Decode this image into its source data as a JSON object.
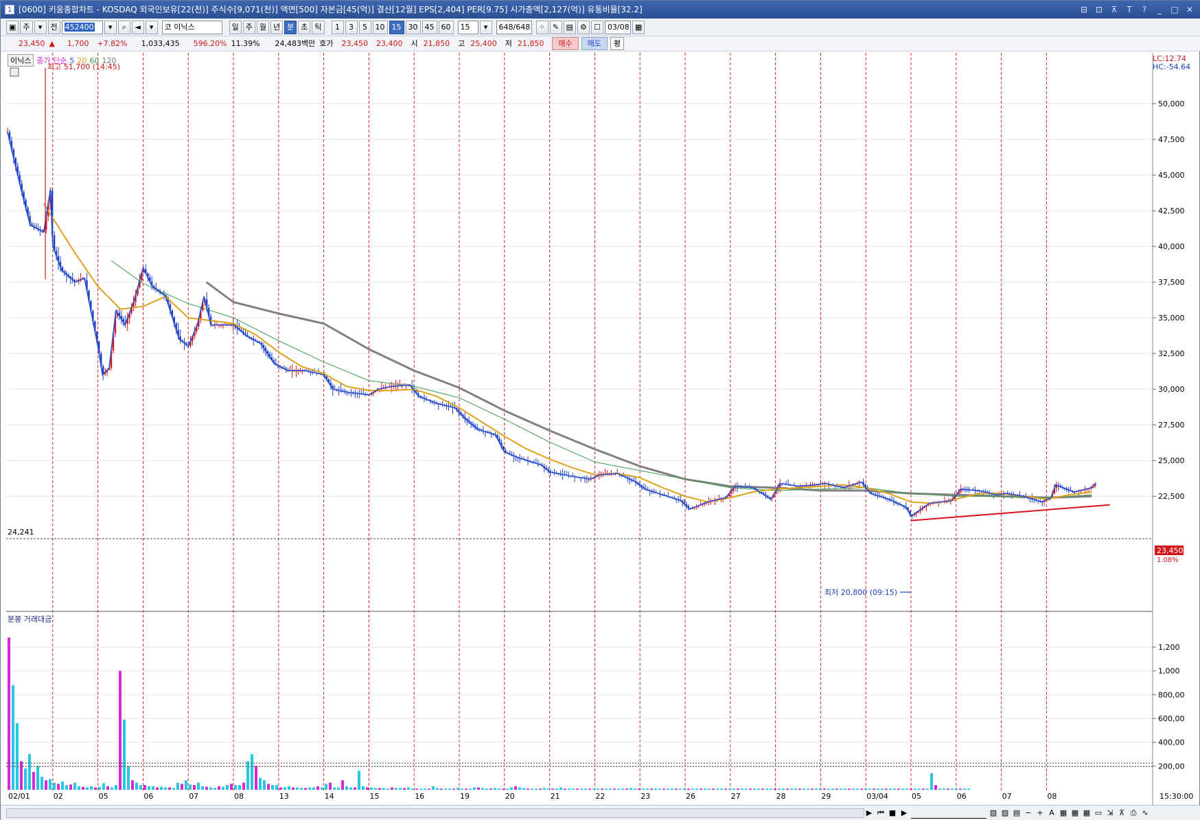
{
  "window": {
    "number": "1",
    "title": "[0600] 키움종합차트 - KOSDAQ 외국인보유[22(천)] 주식수[9,071(천)] 액면[500] 자본금[45(억)] 결산[12월] EPS[2,404] PER[9.75] 시가총액[2,127(억)] 유통비율[32.2]",
    "controls": [
      "⊟",
      "⊡",
      "⊼",
      "T",
      "?",
      "_",
      "□",
      "✕"
    ]
  },
  "toolbar": {
    "market_type": "주",
    "all_label": "전",
    "stock_code": "452400",
    "stock_market": "코",
    "stock_name": "이닉스",
    "periods": [
      "일",
      "주",
      "월",
      "년",
      "분",
      "초",
      "틱"
    ],
    "active_period": "분",
    "intervals": [
      "1",
      "3",
      "5",
      "10",
      "15",
      "30",
      "45",
      "60"
    ],
    "active_interval": "15",
    "interval_select": "15",
    "count": "648",
    "count_total": "/648",
    "date": "03/08"
  },
  "quote": {
    "price": "23,450",
    "change_arrow": "▲",
    "change": "1,700",
    "change_rate": "+7.82%",
    "volume": "1,033,435",
    "volume_rate": "596.20%",
    "turnover": "11.39%",
    "amount": "24,483백만",
    "bid_label": "호가",
    "ask_price": "23,450",
    "bid_price": "23,400",
    "open_label": "시",
    "open": "21,850",
    "high_label": "고",
    "high": "25,400",
    "low_label": "저",
    "low": "21,850",
    "buy_label": "매수",
    "sell_label": "매도",
    "flat_label": "평"
  },
  "legend": {
    "stock": "이닉스",
    "ma_label": "종가 단순",
    "ma": [
      {
        "period": "5",
        "color": "#2b4ecf"
      },
      {
        "period": "20",
        "color": "#e0a11a"
      },
      {
        "period": "60",
        "color": "#3a9b4a"
      },
      {
        "period": "120",
        "color": "#777777"
      }
    ],
    "lc": "LC:12.74",
    "hc": "HC:-54.64",
    "volume_title": "분봉 거래대금"
  },
  "annotations": {
    "high": "최고 51,700 (14:45)",
    "low": "최저 20,800 (09:15)",
    "ref_value": "24,241",
    "last_price": "23,450",
    "last_rate": "1.08%",
    "time_label": "15:30:00"
  },
  "chart_data": [
    {
      "type": "candlestick",
      "title": "",
      "ylim": [
        20000,
        52500
      ],
      "y_ticks": [
        "50,000",
        "47,500",
        "45,000",
        "42,500",
        "40,000",
        "37,500",
        "35,000",
        "32,500",
        "30,000",
        "27,500",
        "25,000",
        "22,500"
      ],
      "x_ticks": [
        "02/01",
        "02",
        "05",
        "06",
        "07",
        "08",
        "13",
        "14",
        "15",
        "16",
        "19",
        "20",
        "21",
        "22",
        "23",
        "26",
        "27",
        "28",
        "29",
        "03/04",
        "05",
        "06",
        "07",
        "08"
      ],
      "close_path": [
        [
          0,
          48000
        ],
        [
          0.3,
          44000
        ],
        [
          0.5,
          41500
        ],
        [
          0.8,
          41000
        ],
        [
          0.95,
          44000
        ],
        [
          1,
          40000
        ],
        [
          1.2,
          38300
        ],
        [
          1.5,
          37500
        ],
        [
          1.7,
          37800
        ],
        [
          2,
          33000
        ],
        [
          2.1,
          31000
        ],
        [
          2.25,
          31500
        ],
        [
          2.4,
          35500
        ],
        [
          2.6,
          34500
        ],
        [
          2.8,
          36200
        ],
        [
          3,
          38500
        ],
        [
          3.2,
          37200
        ],
        [
          3.5,
          36500
        ],
        [
          3.8,
          33500
        ],
        [
          4,
          33000
        ],
        [
          4.2,
          34500
        ],
        [
          4.35,
          36500
        ],
        [
          4.5,
          34500
        ],
        [
          4.8,
          34500
        ],
        [
          5,
          34500
        ],
        [
          5.3,
          33700
        ],
        [
          5.6,
          33200
        ],
        [
          5.9,
          31800
        ],
        [
          6.2,
          31300
        ],
        [
          6.6,
          31300
        ],
        [
          7,
          31000
        ],
        [
          7.2,
          30000
        ],
        [
          7.5,
          29800
        ],
        [
          8,
          29600
        ],
        [
          8.2,
          30000
        ],
        [
          8.5,
          30200
        ],
        [
          8.9,
          30300
        ],
        [
          9.1,
          29500
        ],
        [
          9.5,
          29000
        ],
        [
          9.9,
          28700
        ],
        [
          10.1,
          28000
        ],
        [
          10.4,
          27200
        ],
        [
          10.8,
          26800
        ],
        [
          11,
          25600
        ],
        [
          11.3,
          25200
        ],
        [
          11.8,
          24700
        ],
        [
          12,
          24200
        ],
        [
          12.5,
          23900
        ],
        [
          12.9,
          23700
        ],
        [
          13.1,
          24000
        ],
        [
          13.5,
          24100
        ],
        [
          13.9,
          23500
        ],
        [
          14.1,
          23000
        ],
        [
          14.5,
          22600
        ],
        [
          14.9,
          22200
        ],
        [
          15.1,
          21600
        ],
        [
          15.5,
          22100
        ],
        [
          15.9,
          22400
        ],
        [
          16.1,
          23200
        ],
        [
          16.5,
          23100
        ],
        [
          16.9,
          22300
        ],
        [
          17.1,
          23400
        ],
        [
          17.5,
          23200
        ],
        [
          17.9,
          23300
        ],
        [
          18.1,
          23400
        ],
        [
          18.5,
          23100
        ],
        [
          18.9,
          23500
        ],
        [
          19.1,
          22700
        ],
        [
          19.5,
          22300
        ],
        [
          19.9,
          21700
        ],
        [
          20,
          21100
        ],
        [
          20.4,
          22000
        ],
        [
          20.9,
          22200
        ],
        [
          21.1,
          23000
        ],
        [
          21.5,
          22900
        ],
        [
          21.9,
          22600
        ],
        [
          22.1,
          22700
        ],
        [
          22.5,
          22500
        ],
        [
          22.9,
          22100
        ],
        [
          23.1,
          22400
        ],
        [
          23.2,
          23300
        ],
        [
          23.6,
          22800
        ],
        [
          24,
          23100
        ],
        [
          24.1,
          23450
        ]
      ],
      "ma20_path": [
        [
          0.8,
          43000
        ],
        [
          1.5,
          39500
        ],
        [
          2,
          37200
        ],
        [
          2.5,
          35600
        ],
        [
          3,
          35800
        ],
        [
          3.5,
          36500
        ],
        [
          4,
          35000
        ],
        [
          4.5,
          34800
        ],
        [
          5,
          34600
        ],
        [
          5.5,
          33800
        ],
        [
          6,
          32600
        ],
        [
          6.5,
          31600
        ],
        [
          7,
          31100
        ],
        [
          7.5,
          30200
        ],
        [
          8,
          29900
        ],
        [
          8.5,
          29900
        ],
        [
          9,
          30000
        ],
        [
          9.5,
          29500
        ],
        [
          10,
          28700
        ],
        [
          10.5,
          27700
        ],
        [
          11,
          26700
        ],
        [
          11.5,
          25800
        ],
        [
          12,
          25100
        ],
        [
          12.5,
          24500
        ],
        [
          13,
          24000
        ],
        [
          13.5,
          24100
        ],
        [
          14,
          23800
        ],
        [
          14.5,
          23100
        ],
        [
          15,
          22500
        ],
        [
          15.5,
          22100
        ],
        [
          16,
          22400
        ],
        [
          16.5,
          22800
        ],
        [
          17,
          23000
        ],
        [
          17.5,
          23100
        ],
        [
          18,
          23200
        ],
        [
          18.5,
          23300
        ],
        [
          19,
          23100
        ],
        [
          19.5,
          22700
        ],
        [
          20,
          22100
        ],
        [
          20.5,
          22000
        ],
        [
          21,
          22300
        ],
        [
          21.5,
          22700
        ],
        [
          22,
          22700
        ],
        [
          22.5,
          22500
        ],
        [
          23,
          22300
        ],
        [
          23.5,
          22600
        ],
        [
          24,
          22800
        ]
      ],
      "ma60_path": [
        [
          2.3,
          39000
        ],
        [
          3,
          37400
        ],
        [
          4,
          36000
        ],
        [
          5,
          35000
        ],
        [
          6,
          33400
        ],
        [
          7,
          31900
        ],
        [
          8,
          30600
        ],
        [
          9,
          30200
        ],
        [
          10,
          29400
        ],
        [
          11,
          27900
        ],
        [
          12,
          26300
        ],
        [
          13,
          24900
        ],
        [
          14,
          24300
        ],
        [
          15,
          23700
        ],
        [
          16,
          23100
        ],
        [
          17,
          22900
        ],
        [
          18,
          23000
        ],
        [
          19,
          23100
        ],
        [
          20,
          22700
        ],
        [
          21,
          22500
        ],
        [
          22,
          22500
        ],
        [
          23,
          22400
        ],
        [
          24,
          22600
        ]
      ],
      "ma120_path": [
        [
          4.4,
          37500
        ],
        [
          5,
          36100
        ],
        [
          6,
          35300
        ],
        [
          7,
          34600
        ],
        [
          8,
          32800
        ],
        [
          9,
          31300
        ],
        [
          10,
          30100
        ],
        [
          11,
          28500
        ],
        [
          12,
          27100
        ],
        [
          13,
          25800
        ],
        [
          14,
          24600
        ],
        [
          15,
          23700
        ],
        [
          16,
          23200
        ],
        [
          17,
          23100
        ],
        [
          18,
          22900
        ],
        [
          19,
          22900
        ],
        [
          20,
          22700
        ],
        [
          21,
          22600
        ],
        [
          22,
          22500
        ],
        [
          23,
          22400
        ],
        [
          24,
          22500
        ]
      ],
      "trendline": [
        [
          20,
          20800
        ],
        [
          24.4,
          21900
        ]
      ]
    },
    {
      "type": "bar",
      "title": "분봉 거래대금",
      "ylim": [
        0,
        1350
      ],
      "y_ticks": [
        "1,200",
        "1,000",
        "800,00",
        "600,00",
        "400,00",
        "200,00"
      ],
      "values": [
        1280,
        880,
        560,
        240,
        180,
        300,
        150,
        200,
        110,
        80,
        90,
        60,
        50,
        70,
        40,
        45,
        60,
        30,
        25,
        20,
        30,
        20,
        25,
        55,
        30,
        20,
        40,
        1000,
        590,
        200,
        80,
        60,
        40,
        40,
        30,
        30,
        20,
        25,
        20,
        20,
        15,
        60,
        50,
        80,
        45,
        40,
        60,
        30,
        25,
        20,
        15,
        30,
        25,
        40,
        50,
        40,
        40,
        60,
        240,
        300,
        200,
        100,
        80,
        50,
        40,
        40,
        20,
        20,
        30,
        20,
        20,
        15,
        15,
        20,
        20,
        30,
        20,
        50,
        60,
        20,
        20,
        80,
        30,
        20,
        20,
        160,
        30,
        20,
        20,
        15,
        15,
        15,
        10,
        20,
        15,
        15,
        15,
        20,
        10,
        10,
        10,
        10,
        10,
        30,
        15,
        10,
        10,
        10,
        10,
        15,
        10,
        10,
        10,
        20,
        20,
        15,
        10,
        10,
        15,
        10,
        10,
        10,
        20,
        30,
        20,
        15,
        10,
        10,
        10,
        10,
        15,
        10,
        10,
        10,
        20,
        10,
        10,
        10,
        10,
        10,
        10,
        10,
        10,
        10,
        10,
        10,
        10,
        10,
        10,
        10,
        10,
        15,
        10,
        10,
        10,
        10,
        10,
        10,
        10,
        10,
        10,
        10,
        10,
        10,
        10,
        10,
        10,
        10,
        10,
        10,
        10,
        10,
        10,
        10,
        10,
        10,
        10,
        10,
        10,
        10,
        10,
        10,
        10,
        10,
        10,
        10,
        10,
        10,
        10,
        10,
        10,
        10,
        10,
        10,
        10,
        10,
        10,
        10,
        10,
        10,
        10,
        10,
        10,
        10,
        10,
        10,
        10,
        10,
        10,
        10,
        10,
        10,
        10,
        10,
        10,
        10,
        10,
        10,
        10,
        10,
        10,
        10,
        10,
        10,
        140,
        40,
        10,
        10,
        10,
        10,
        10,
        10,
        10,
        10
      ]
    }
  ],
  "colors": {
    "up": "#d4161a",
    "down": "#1a3fc4",
    "vline": "#d42020",
    "vol_cyan": "#27c8e0",
    "vol_magenta": "#d628d6"
  }
}
